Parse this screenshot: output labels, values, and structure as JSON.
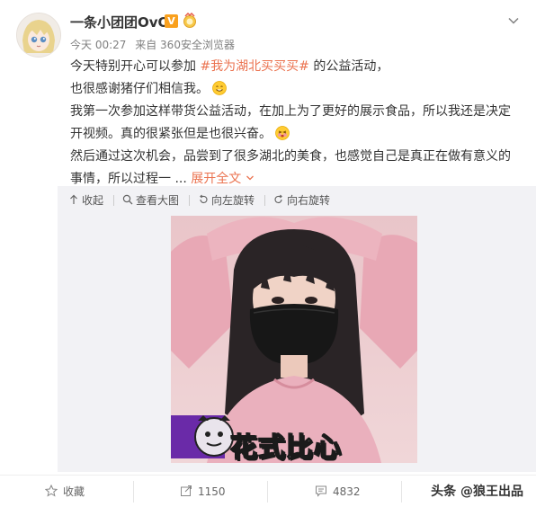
{
  "post": {
    "username": "一条小团团OvO",
    "verified_badge": "V",
    "time": "今天 00:27",
    "source": "来自 360安全浏览器",
    "paragraphs": [
      {
        "before": "今天特别开心可以参加 ",
        "topic": "#我为湖北买买买#",
        "after": " 的公益活动，"
      },
      {
        "text": "也很感谢猪仔们相信我。"
      },
      {
        "text": "我第一次参加这样带货公益活动，在加上为了更好的展示食品，所以我还是决定开视频。真的很紧张但是也很兴奋。"
      },
      {
        "text": "然后通过这次机会，品尝到了很多湖北的美食，也感觉自己是真正在做有意义的事情，所以过程一 ... ",
        "expand": "展开全文"
      }
    ],
    "icons": [
      "avatar",
      "vip-badge-icon",
      "medal-icon",
      "chevron-down-icon",
      "smile-emoji-icon",
      "excited-emoji-icon"
    ]
  },
  "media_toolbar": {
    "collapse": "收起",
    "view_large": "查看大图",
    "rotate_left": "向左旋转",
    "rotate_right": "向右旋转"
  },
  "photo": {
    "sticker_text": "花式比心"
  },
  "footer": {
    "favorite": "收藏",
    "repost_count": "1150",
    "comment_count": "4832",
    "watermark": "头条 @狼王出品"
  },
  "colors": {
    "accent": "#eb7350",
    "badge": "#f9a01d",
    "text": "#333333",
    "meta": "#808080",
    "media_bg": "#f2f2f5"
  }
}
